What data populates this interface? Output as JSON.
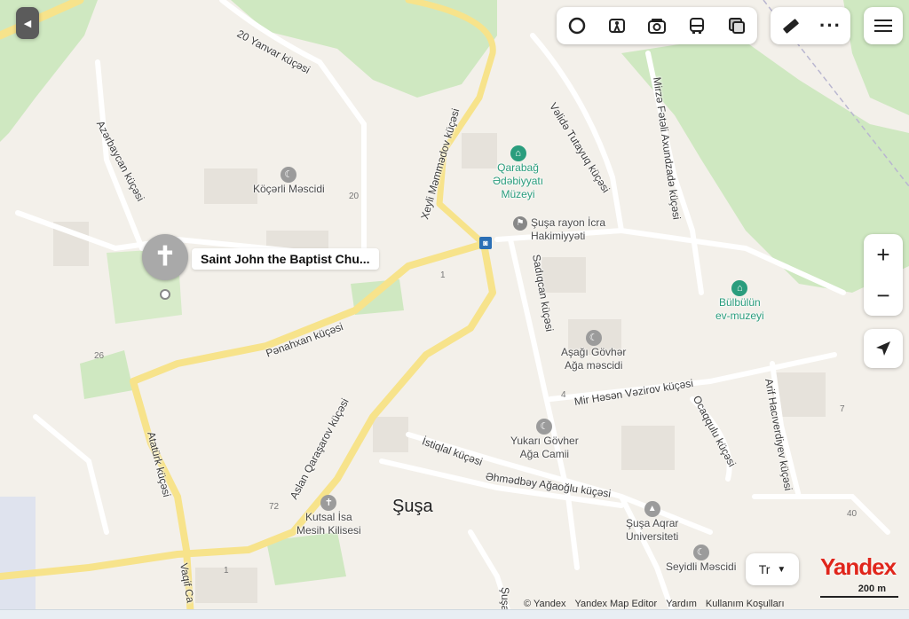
{
  "toolbar": {
    "items": [
      "layers-icon",
      "panorama-icon",
      "camera-icon",
      "bus-icon",
      "traffic-icon"
    ],
    "tools": [
      "ruler-icon",
      "more-icon"
    ],
    "menu": "menu-icon"
  },
  "zoom": {
    "plus": "+",
    "minus": "−"
  },
  "selected_poi": {
    "label": "Saint John the Baptist Chu..."
  },
  "pois": {
    "museum1": "Qarabağ\nƏdəbiyyatı\nMüzeyi",
    "gov": "Şuşa rayon İcra\nHakimiyyəti",
    "mosque1": "Köçərli Məscidi",
    "museum2": "Bülbülün\nev-muzeyi",
    "mosque2": "Aşağı Gövhər\nAğa məscidi",
    "mosque3": "Yukarı Gövher\nAğa Camii",
    "church": "Kutsal İsa\nMesih Kilisesi",
    "univ": "Şuşa Aqrar\nUniversiteti",
    "mosque4": "Seyidli Məscidi"
  },
  "city": "Şuşa",
  "streets": {
    "s1": "20 Yanvar küçəsi",
    "s2": "Azərbaycan küçəsi",
    "s3": "Xeyli Məmmədov küçəsi",
    "s4": "Vəlidə Tutayuq küçəsi",
    "s5": "Mirzə Fətəli Axundzadə küçəsi",
    "s6": "Sadıqcan küçəsi",
    "s7": "Pənahxan küçəsi",
    "s8": "Mir Həsən Vəzirov küçəsi",
    "s9": "Ocaqqulu küçəsi",
    "s10": "Arif Hacıverdiyev küçəsi",
    "s11": "Aslan Qaraşarov küçəsi",
    "s12": "Atatürk küçəsi",
    "s13": "İstiqlal küçəsi",
    "s14": "Əhmədbəy Ağaoğlu küçəsi",
    "s15": "Vaqif Ca",
    "s16": "Şuşa"
  },
  "numbers": [
    "20",
    "26",
    "72",
    "1",
    "4",
    "7",
    "40",
    "1"
  ],
  "language": "Tr",
  "brand": "Yandex",
  "footer": {
    "copyright": "© Yandex",
    "editor": "Yandex Map Editor",
    "help": "Yardım",
    "terms": "Kullanım Koşulları"
  },
  "scale": "200 m",
  "colors": {
    "park": "#cfe8c1",
    "road_major": "#f7e38b",
    "water": "#aad3df",
    "accent": "#2a9d7d",
    "brand_red": "#e0261c"
  }
}
